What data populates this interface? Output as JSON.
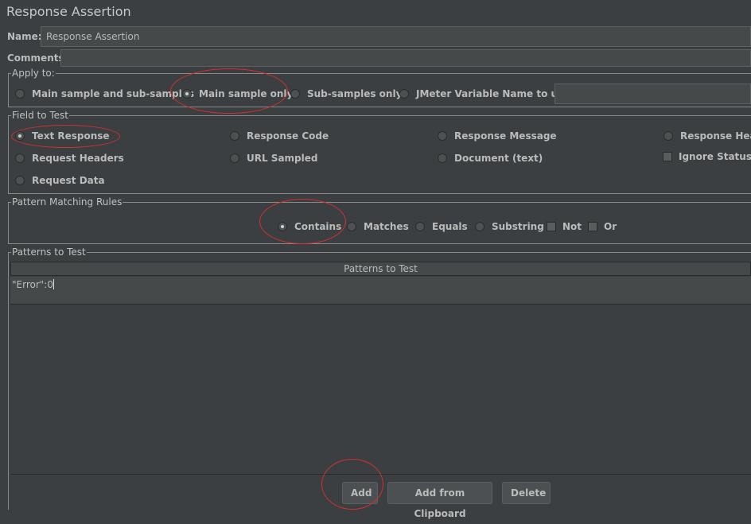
{
  "title": "Response Assertion",
  "name_label": "Name:",
  "name_value": "Response Assertion",
  "comments_label": "Comments:",
  "apply_to": {
    "legend": "Apply to:",
    "options": [
      "Main sample and sub-samples",
      "Main sample only",
      "Sub-samples only",
      "JMeter Variable Name to use"
    ],
    "selected": "Main sample only",
    "variable_value": ""
  },
  "field_to_test": {
    "legend": "Field to Test",
    "options": [
      "Text Response",
      "Response Code",
      "Response Message",
      "Response Head",
      "Request Headers",
      "URL Sampled",
      "Document (text)",
      "Request Data"
    ],
    "ignore_status_label": "Ignore Status",
    "ignore_status_checked": false,
    "selected": "Text Response"
  },
  "pattern_matching_rules": {
    "legend": "Pattern Matching Rules",
    "options": [
      "Contains",
      "Matches",
      "Equals",
      "Substring"
    ],
    "selected": "Contains",
    "not_label": "Not",
    "or_label": "Or",
    "not_checked": false,
    "or_checked": false
  },
  "patterns_to_test": {
    "legend": "Patterns to Test",
    "column_header": "Patterns to Test",
    "rows": [
      "\"Error\":0"
    ]
  },
  "buttons": {
    "add": "Add",
    "add_from_clipboard": "Add from Clipboard",
    "delete": "Delete"
  },
  "colors": {
    "background": "#3c3f41",
    "annotation_circle": "#d03030"
  }
}
